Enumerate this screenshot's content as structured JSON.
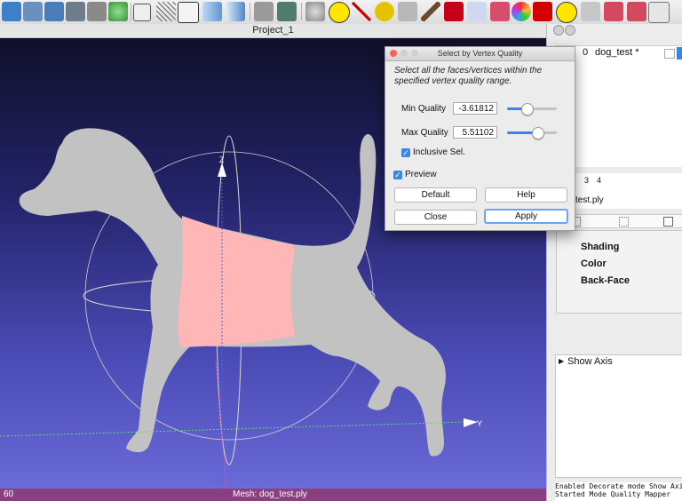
{
  "viewport": {
    "title": "Project_1",
    "axis_z": "Z",
    "axis_y": "Y",
    "status_left": "60",
    "status_mesh": "Mesh: dog_test.ply"
  },
  "dialog": {
    "title": "Select by Vertex Quality",
    "description": "Select all the faces/vertices within the specified vertex quality range.",
    "min_label": "Min Quality",
    "min_value": "-3.61812",
    "min_slider": 0.4,
    "max_label": "Max Quality",
    "max_value": "5.51102",
    "max_slider": 0.6,
    "inclusive_label": "Inclusive Sel.",
    "inclusive_checked": true,
    "preview_label": "Preview",
    "preview_checked": true,
    "default_label": "Default",
    "help_label": "Help",
    "close_label": "Close",
    "apply_label": "Apply"
  },
  "right_panel": {
    "layer_index": "0",
    "layer_name": "dog_test *",
    "col3": "3",
    "col4": "4",
    "raster_name": "test.ply",
    "decorators": [
      "Shading",
      "Color",
      "Back-Face"
    ],
    "filter_item": "Show Axis",
    "log": [
      "Enabled Decorate mode Show Axis",
      "Started Mode Quality Mapper"
    ]
  },
  "colors": {
    "selection": "#ffb6b6",
    "mesh": "#c2c2c2",
    "accent": "#3b86e4",
    "status": "#8a3f7e"
  }
}
